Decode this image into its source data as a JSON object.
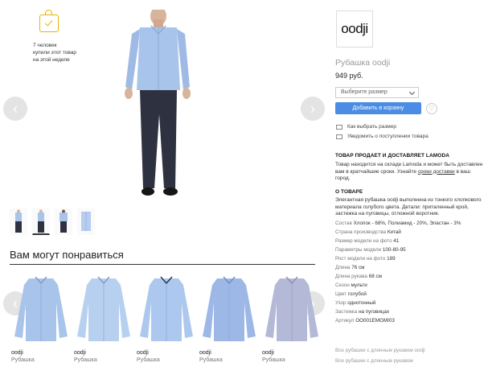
{
  "promo": {
    "line1": "7 человек",
    "line2": "купили этот товар",
    "line3": "на этой неделе"
  },
  "gallery": {
    "prev": "‹",
    "next": "›"
  },
  "recommendations": {
    "title": "Вам могут понравиться",
    "items": [
      {
        "brand": "oodji",
        "category": "Рубашка"
      },
      {
        "brand": "oodji",
        "category": "Рубашка"
      },
      {
        "brand": "oodji",
        "category": "Рубашка"
      },
      {
        "brand": "oodji",
        "category": "Рубашка"
      },
      {
        "brand": "oodji",
        "category": "Рубашка"
      }
    ]
  },
  "product": {
    "logo": "oodji",
    "title": "Рубашка oodji",
    "price": "949 руб.",
    "size_placeholder": "Выберите размер",
    "add_to_cart": "Добавить в корзину",
    "fav": "♡",
    "how_to_choose": "Как выбрать размер",
    "notify": "Уведомить о поступлении товара"
  },
  "seller": {
    "title": "ТОВАР ПРОДАЕТ И ДОСТАВЛЯЕТ LAMODA",
    "text_part1": "Товар находится на складе Lamoda и может быть доставлен вам в кратчайшие сроки. Узнайте ",
    "text_link": "сроки доставки",
    "text_part2": " в ваш город."
  },
  "about": {
    "title": "О ТОВАРЕ",
    "description": "Элегантная рубашка oodji выполнена из тонкого хлопкового материала голубого цвета. Детали: приталенный крой, застежка на пуговицы, отложной воротник.",
    "attributes": [
      {
        "label": "Состав",
        "value": "Хлопок - 68%, Полиамид - 20%, Эластан - 3%"
      },
      {
        "label": "Страна производства",
        "value": "Китай"
      },
      {
        "label": "Размер модели на фото",
        "value": "41"
      },
      {
        "label": "Параметры модели",
        "value": "100-80-95"
      },
      {
        "label": "Рост модели на фото",
        "value": "189"
      },
      {
        "label": "Длина",
        "value": "76 см"
      },
      {
        "label": "Длина рукава",
        "value": "68 см"
      },
      {
        "label": "Сезон",
        "value": "мульти"
      },
      {
        "label": "Цвет",
        "value": "голубой"
      },
      {
        "label": "Узор",
        "value": "однотонный"
      },
      {
        "label": "Застежка",
        "value": "на пуговицах"
      },
      {
        "label": "Артикул",
        "value": "OO001EMGMI03"
      }
    ]
  },
  "footer_links": [
    "Все рубашки с длинным рукавом oodji",
    "Все рубашки с длинным рукавом"
  ],
  "colors": {
    "accent": "#4b8de5",
    "shirt": "#a9c4ea",
    "pants": "#2e3140"
  }
}
